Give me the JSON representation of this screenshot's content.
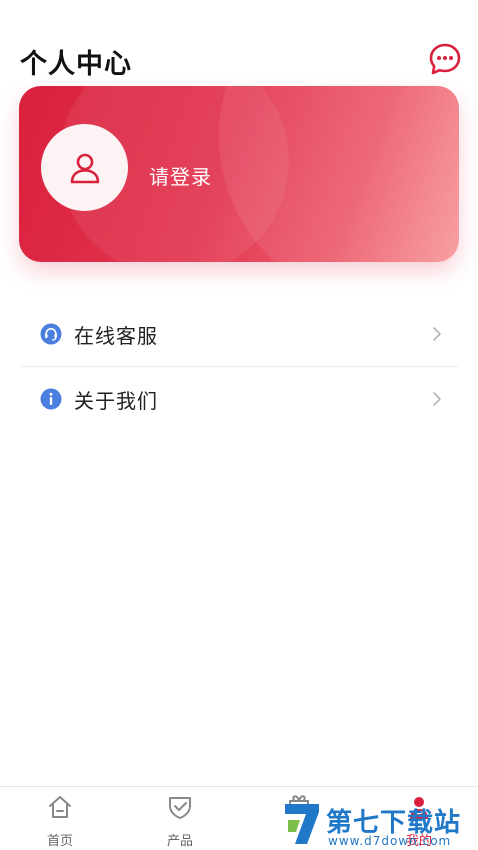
{
  "header": {
    "title": "个人中心",
    "message_icon": "chat-bubble-icon"
  },
  "profile_card": {
    "avatar_icon": "user-icon",
    "login_prompt": "请登录"
  },
  "menu": {
    "items": [
      {
        "icon": "headset-icon",
        "label": "在线客服"
      },
      {
        "icon": "info-icon",
        "label": "关于我们"
      }
    ]
  },
  "tabbar": {
    "tabs": [
      {
        "icon": "home-icon",
        "label": "首页",
        "active": false
      },
      {
        "icon": "shield-check-icon",
        "label": "产品",
        "active": false
      },
      {
        "icon": "gift-icon",
        "label": "",
        "active": false
      },
      {
        "icon": "user-icon",
        "label": "我的",
        "active": true
      }
    ]
  },
  "watermark": {
    "title": "第七下载站",
    "url": "www.d7down.com"
  },
  "colors": {
    "accent": "#d9203d",
    "card_gradient_end": "#f7999c",
    "icon_blue": "#4a7fe0",
    "watermark_blue": "#1f78c8"
  }
}
